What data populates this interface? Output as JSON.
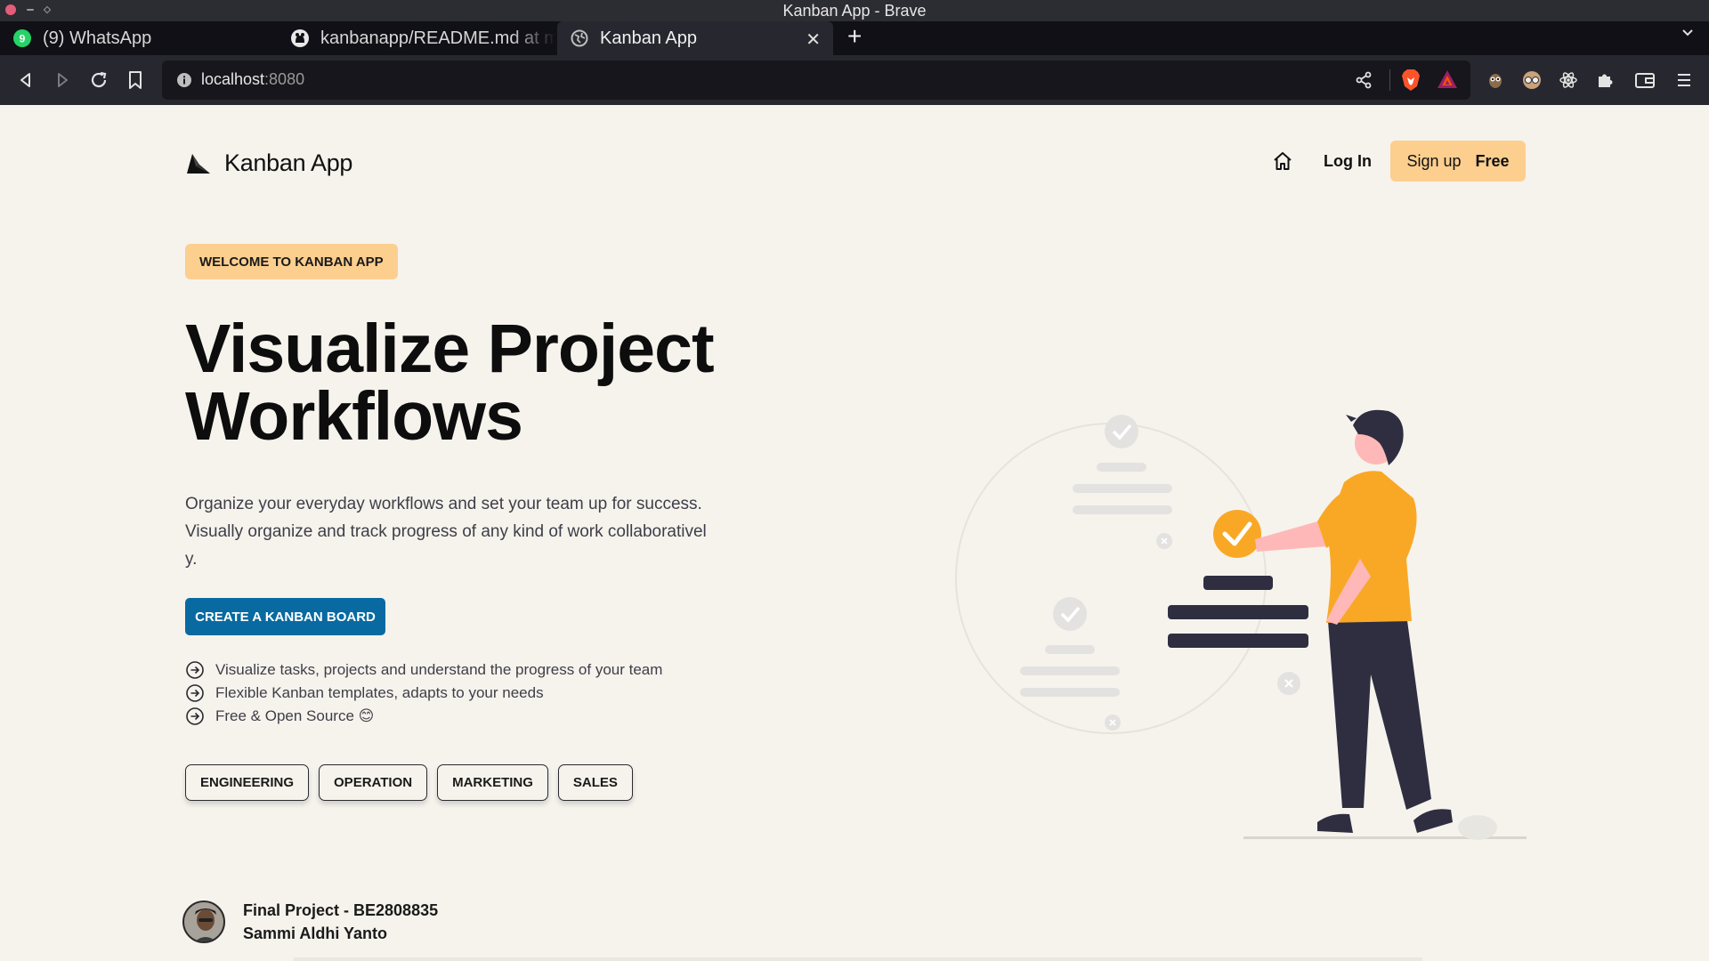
{
  "window": {
    "title": "Kanban App - Brave"
  },
  "tabs": [
    {
      "label": "(9) WhatsApp",
      "icon": "whatsapp-icon"
    },
    {
      "label": "kanbanapp/README.md at main",
      "icon": "github-icon"
    },
    {
      "label": "Kanban App",
      "icon": "globe-icon",
      "active": true
    }
  ],
  "addressbar": {
    "host": "localhost",
    "port": ":8080"
  },
  "app": {
    "logo_text": "Kanban App",
    "nav": {
      "login": "Log In",
      "signup": "Sign up",
      "signup_free": "Free"
    },
    "badge": "WELCOME TO KANBAN APP",
    "hero": {
      "title_line1": "Visualize Project",
      "title_line2": "Workflows",
      "description": "Organize your everyday workflows and set your team up for success. Visually organize and track progress of any kind of work collaboratively."
    },
    "cta": "CREATE A KANBAN BOARD",
    "features": [
      "Visualize tasks, projects and understand the progress of your team",
      "Flexible Kanban templates, adapts to your needs",
      "Free & Open Source 😊"
    ],
    "tags": [
      "ENGINEERING",
      "OPERATION",
      "MARKETING",
      "SALES"
    ],
    "author": {
      "line1": "Final Project - BE2808835",
      "line2": "Sammi Aldhi Yanto"
    }
  },
  "colors": {
    "accent": "#fccf8f",
    "cta": "#086aa0",
    "illustration": "#f9a826",
    "background": "#f6f3ed"
  }
}
